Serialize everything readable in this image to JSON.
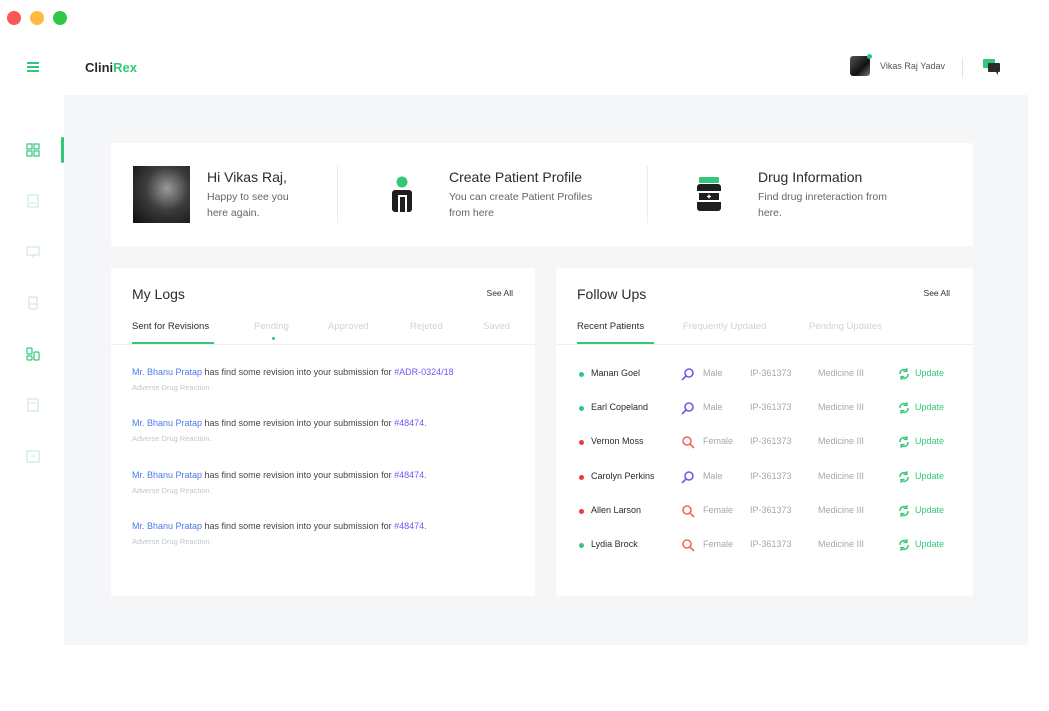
{
  "app": {
    "name_part1": "Clini",
    "name_part2": "Rex"
  },
  "user": {
    "name": "Vikas Raj Yadav"
  },
  "welcome": {
    "greeting": "Hi Vikas Raj,",
    "message_line1": "Happy to see you",
    "message_line2": "here again.",
    "create_title": "Create Patient Profile",
    "create_line1": "You can create Patient Profiles",
    "create_line2": "from here",
    "drug_title": "Drug Information",
    "drug_line1": "Find drug inreteraction from",
    "drug_line2": "here."
  },
  "logs": {
    "title": "My Logs",
    "see_all": "See All",
    "tabs": [
      "Sent for Revisions",
      "Pending",
      "Approved",
      "Rejeted",
      "Saved"
    ],
    "items": [
      {
        "name": "Mr. Bhanu Pratap",
        "text": " has find some revision into your submission for ",
        "ref": "#ADR-0324/18",
        "sub": "Adverse Drug Reaction."
      },
      {
        "name": "Mr. Bhanu Pratap",
        "text": " has find some revision into your submission for ",
        "ref": "#48474.",
        "sub": "Adverse Drug Reaction."
      },
      {
        "name": "Mr. Bhanu Pratap",
        "text": " has find some revision into your submission for ",
        "ref": "#48474.",
        "sub": "Adverse Drug Reaction."
      },
      {
        "name": "Mr. Bhanu Pratap",
        "text": " has find some revision into your submission for ",
        "ref": "#48474.",
        "sub": "Adverse Drug Reaction."
      }
    ]
  },
  "followups": {
    "title": "Follow Ups",
    "see_all": "See All",
    "tabs": [
      "Recent Patients",
      "Frequently Updated",
      "Pending Updates"
    ],
    "rows": [
      {
        "name": "Manan Goel",
        "gender": "Male",
        "id": "IP-361373",
        "dept": "Medicine III",
        "action": "Update",
        "status_color": "#34c77b",
        "gender_icon": "male-icon"
      },
      {
        "name": "Earl Copeland",
        "gender": "Male",
        "id": "IP-361373",
        "dept": "Medicine III",
        "action": "Update",
        "status_color": "#34c77b",
        "gender_icon": "male-icon"
      },
      {
        "name": "Vernon Moss",
        "gender": "Female",
        "id": "IP-361373",
        "dept": "Medicine III",
        "action": "Update",
        "status_color": "#e83b3b",
        "gender_icon": "female-icon"
      },
      {
        "name": "Carolyn Perkins",
        "gender": "Male",
        "id": "IP-361373",
        "dept": "Medicine III",
        "action": "Update",
        "status_color": "#e83b3b",
        "gender_icon": "male-icon"
      },
      {
        "name": "Allen Larson",
        "gender": "Female",
        "id": "IP-361373",
        "dept": "Medicine III",
        "action": "Update",
        "status_color": "#e83b3b",
        "gender_icon": "female-icon"
      },
      {
        "name": "Lydia Brock",
        "gender": "Female",
        "id": "IP-361373",
        "dept": "Medicine III",
        "action": "Update",
        "status_color": "#34c77b",
        "gender_icon": "female-icon"
      }
    ]
  },
  "colors": {
    "accent": "#34c77b",
    "male": "#6b5cf0",
    "female": "#f0695a",
    "link": "#4a7be8"
  }
}
